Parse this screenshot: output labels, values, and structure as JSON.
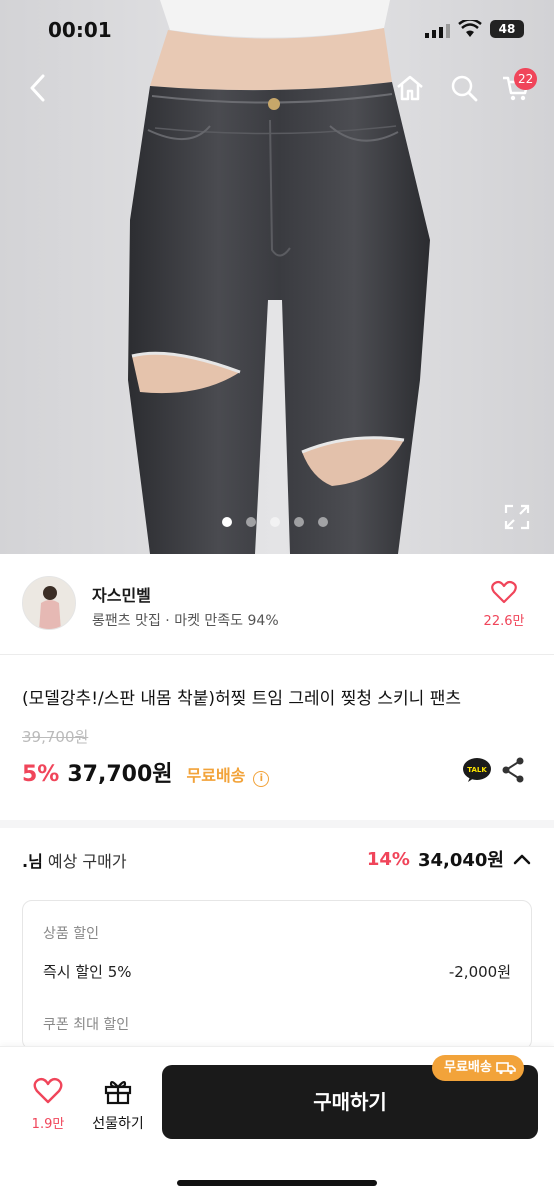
{
  "status_bar": {
    "time": "00:01",
    "battery": "48"
  },
  "header": {
    "cart_count": "22"
  },
  "carousel": {
    "page_count": 5,
    "active_index": 0
  },
  "seller": {
    "name": "자스민벨",
    "subtitle": "롱팬츠 맛집 · 마켓 만족도 94%",
    "like_count": "22.6만"
  },
  "product": {
    "title": "(모델강추!/스판 내몸 착붙)허찢 트임 그레이 찢청 스키니 팬츠",
    "original_price": "39,700원",
    "discount_rate": "5%",
    "price": "37,700원",
    "free_shipping": "무료배송",
    "talk_label": "TALK"
  },
  "expected": {
    "label_prefix": ".님",
    "label": " 예상 구매가",
    "discount_rate": "14%",
    "price": "34,040원"
  },
  "breakdown": {
    "product_discount_title": "상품 할인",
    "instant_discount_label": "즉시 할인 5%",
    "instant_discount_value": "-2,000원",
    "coupon_max_title": "쿠폰 최대 할인"
  },
  "bottom_bar": {
    "like_count": "1.9만",
    "gift_label": "선물하기",
    "buy_label": "구매하기",
    "free_shipping_badge": "무료배송"
  },
  "colors": {
    "accent_red": "#f0455a",
    "free_shipping": "#f2a33a",
    "buy_button": "#1a1a1a"
  }
}
